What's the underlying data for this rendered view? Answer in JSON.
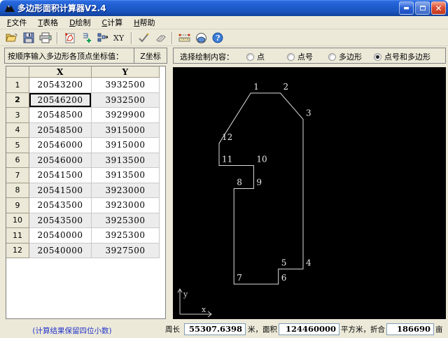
{
  "window": {
    "title": "多边形面积计算器V2.4",
    "controls": [
      {
        "name": "minimize",
        "glyph": "_"
      },
      {
        "name": "maximize",
        "glyph": "□"
      },
      {
        "name": "close",
        "glyph": "×"
      }
    ]
  },
  "menu": {
    "items": [
      {
        "key": "F",
        "label": "文件"
      },
      {
        "key": "T",
        "label": "表格"
      },
      {
        "key": "D",
        "label": "绘制"
      },
      {
        "key": "C",
        "label": "计算"
      },
      {
        "key": "H",
        "label": "帮助"
      }
    ]
  },
  "toolbar": {
    "items": [
      {
        "type": "button",
        "name": "open",
        "icon": "open-folder-icon"
      },
      {
        "type": "button",
        "name": "save",
        "icon": "floppy-save-icon"
      },
      {
        "type": "button",
        "name": "print",
        "icon": "printer-icon"
      },
      {
        "type": "separator"
      },
      {
        "type": "button",
        "name": "new-polygon",
        "icon": "polygon-page-icon"
      },
      {
        "type": "button",
        "name": "insert-row",
        "icon": "insert-row-icon"
      },
      {
        "type": "button",
        "name": "transfer-points",
        "icon": "transfer-points-icon"
      },
      {
        "type": "button",
        "name": "xy-coordinates",
        "icon": "xy-icon"
      },
      {
        "type": "separator"
      },
      {
        "type": "button",
        "name": "calculate",
        "icon": "check-icon"
      },
      {
        "type": "button",
        "name": "erase",
        "icon": "eraser-icon"
      },
      {
        "type": "separator"
      },
      {
        "type": "button",
        "name": "measure",
        "icon": "ruler-icon"
      },
      {
        "type": "button",
        "name": "draw-area",
        "icon": "circle-area-icon"
      },
      {
        "type": "button",
        "name": "help",
        "icon": "help-icon"
      }
    ]
  },
  "left_panel": {
    "header": "按顺序输入多边形各顶点坐标值：",
    "z_button": "Z坐标",
    "table": {
      "columns": [
        "X",
        "Y"
      ],
      "rows": [
        [
          "1",
          "20543200",
          "3932500"
        ],
        [
          "2",
          "20546200",
          "3932500"
        ],
        [
          "3",
          "20548500",
          "3929900"
        ],
        [
          "4",
          "20548500",
          "3915000"
        ],
        [
          "5",
          "20546000",
          "3915000"
        ],
        [
          "6",
          "20546000",
          "3913500"
        ],
        [
          "7",
          "20541500",
          "3913500"
        ],
        [
          "8",
          "20541500",
          "3923000"
        ],
        [
          "9",
          "20543500",
          "3923000"
        ],
        [
          "10",
          "20543500",
          "3925300"
        ],
        [
          "11",
          "20540000",
          "3925300"
        ],
        [
          "12",
          "20540000",
          "3927500"
        ]
      ],
      "selected_cell": {
        "row": "2",
        "column": "X"
      }
    }
  },
  "options": {
    "label": "选择绘制内容：",
    "radios": [
      {
        "name": "point",
        "label": "点",
        "selected": false
      },
      {
        "name": "point-number",
        "label": "点号",
        "selected": false
      },
      {
        "name": "polygon",
        "label": "多边形",
        "selected": false
      },
      {
        "name": "point-number-and-polygon",
        "label": "点号和多边形",
        "selected": true
      }
    ]
  },
  "chart_data": {
    "type": "polygon-plot",
    "title": "",
    "xlabel": "x",
    "ylabel": "y",
    "line_color": "#dcdcdc",
    "background": "#000000",
    "vertices": [
      {
        "id": "1",
        "x": 20543200,
        "y": 3932500
      },
      {
        "id": "2",
        "x": 20546200,
        "y": 3932500
      },
      {
        "id": "3",
        "x": 20548500,
        "y": 3929900
      },
      {
        "id": "4",
        "x": 20548500,
        "y": 3915000
      },
      {
        "id": "5",
        "x": 20546000,
        "y": 3915000
      },
      {
        "id": "6",
        "x": 20546000,
        "y": 3913500
      },
      {
        "id": "7",
        "x": 20541500,
        "y": 3913500
      },
      {
        "id": "8",
        "x": 20541500,
        "y": 3923000
      },
      {
        "id": "9",
        "x": 20543500,
        "y": 3923000
      },
      {
        "id": "10",
        "x": 20543500,
        "y": 3925300
      },
      {
        "id": "11",
        "x": 20540000,
        "y": 3925300
      },
      {
        "id": "12",
        "x": 20540000,
        "y": 3927500
      }
    ],
    "closed": true,
    "xlim": [
      20540000,
      20548500
    ],
    "ylim": [
      3913500,
      3932500
    ]
  },
  "status": {
    "note": "(计算结果保留四位小数)",
    "perimeter_label": "周长",
    "perimeter_value": "55307.6398",
    "area_label": "米，面积",
    "area_value": "124460000",
    "mu_label": "平方米，折合",
    "mu_value": "186690",
    "mu_unit": "亩"
  }
}
